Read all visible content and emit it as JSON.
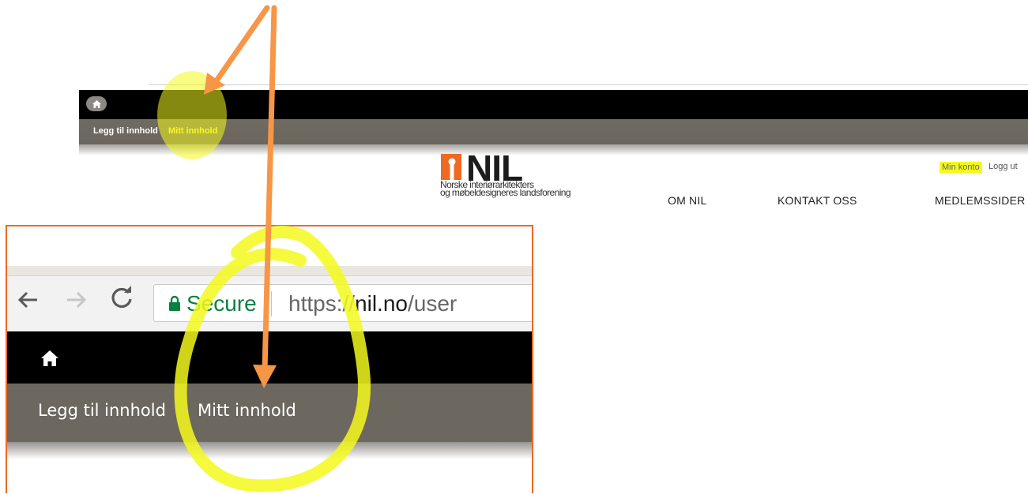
{
  "main": {
    "toolbar": {
      "add_content": "Legg til innhold",
      "my_content": "Mitt innhold"
    },
    "logo": {
      "word": "NIL",
      "subtitle_line1": "Norske interiørarkitekters",
      "subtitle_line2": "og møbeldesigneres landsforening"
    },
    "user_links": {
      "my_account": "Min konto",
      "logout": "Logg ut"
    },
    "nav": [
      "OM NIL",
      "KONTAKT OSS",
      "MEDLEMSSIDER"
    ]
  },
  "inset": {
    "secure_label": "Secure",
    "url": {
      "scheme": "https://",
      "host": "nil.no",
      "path": "/user"
    },
    "toolbar": {
      "add_content": "Legg til innhold",
      "my_content": "Mitt innhold"
    }
  },
  "icons": [
    "home-icon",
    "back-arrow-icon",
    "forward-arrow-icon",
    "reload-icon",
    "lock-icon"
  ],
  "colors": {
    "accent_orange": "#ee6a22",
    "highlight_yellow": "#f4f91c",
    "toolbar_gray": "#6d685f",
    "admin_black": "#000000",
    "secure_green": "#0b8043"
  }
}
